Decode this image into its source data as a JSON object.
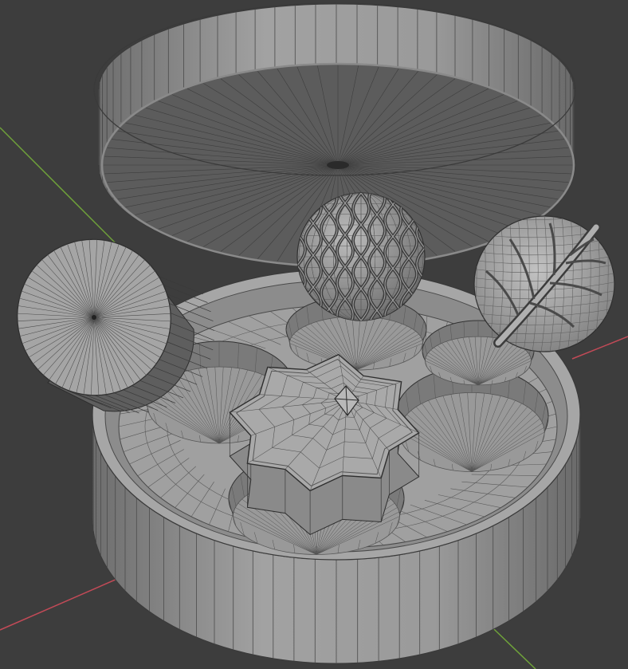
{
  "viewport": {
    "background": "#3d3d3d",
    "grid_color": "#444444",
    "x_axis_color": "#c24a57",
    "y_axis_color": "#6fa23a"
  },
  "objects": [
    {
      "name": "box-lid",
      "shape": "cylinder",
      "segments": 72
    },
    {
      "name": "box-base",
      "shape": "cylinder-with-wells",
      "segments": 72,
      "wells": 5
    },
    {
      "name": "round-candy",
      "shape": "cylinder",
      "segments": 64
    },
    {
      "name": "net-sphere-candy",
      "shape": "uv-sphere",
      "pattern": "net"
    },
    {
      "name": "leaf-candy",
      "shape": "sphere",
      "pattern": "leaf"
    },
    {
      "name": "star-candy",
      "shape": "octagram-prism",
      "points": 8
    }
  ],
  "material": {
    "solid": "#9c9c9c",
    "shade": "#7f7f7f",
    "dark": "#4a4a4a",
    "wire": "#2e2e2e"
  }
}
